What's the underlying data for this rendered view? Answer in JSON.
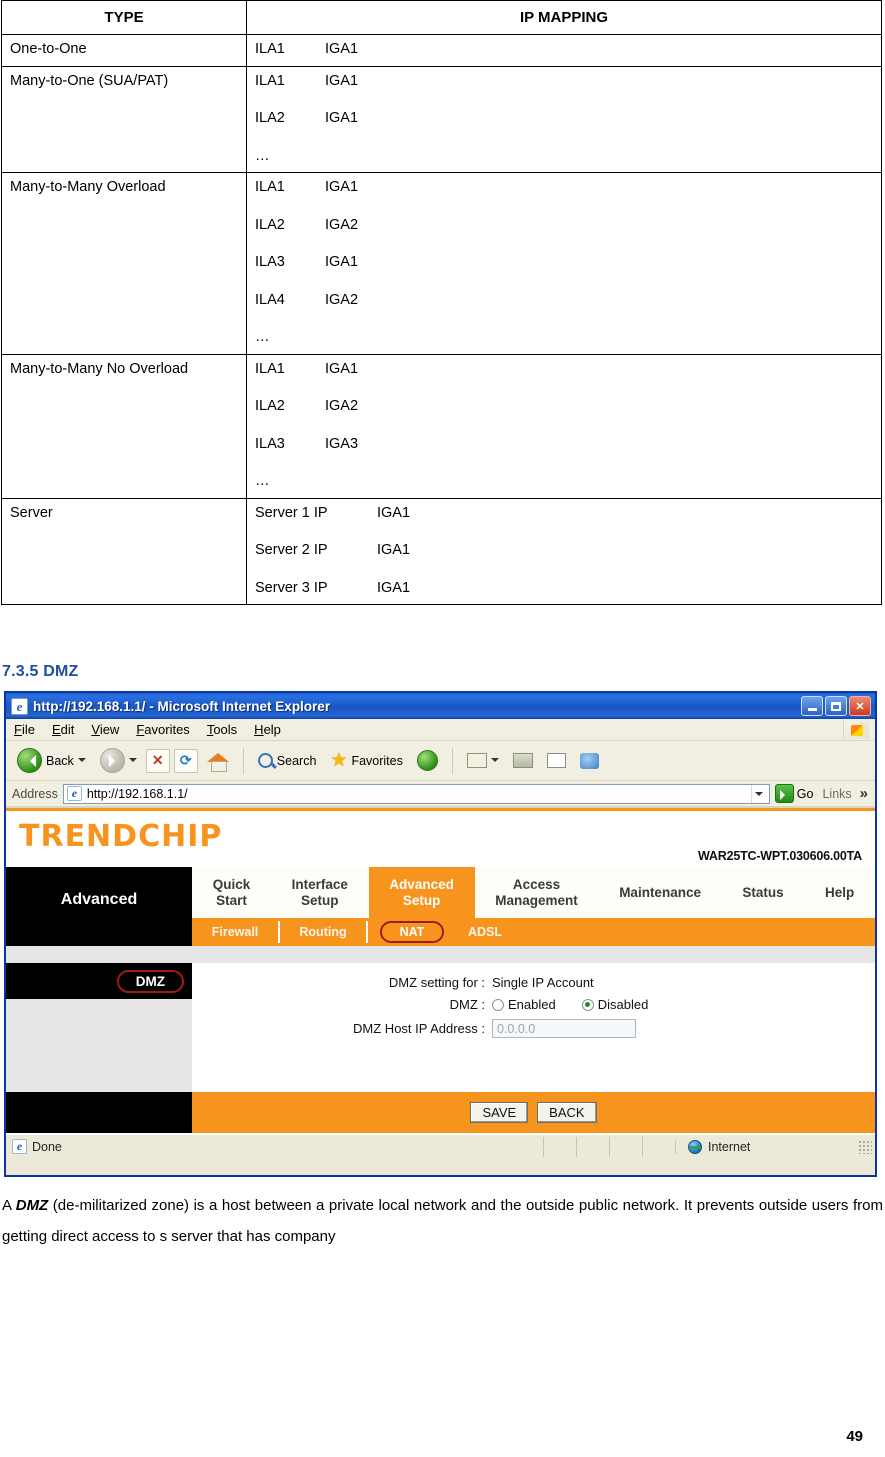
{
  "nat_table": {
    "headers": [
      "TYPE",
      "IP MAPPING"
    ],
    "rows": [
      {
        "type": "One-to-One",
        "mappings": [
          [
            "ILA1",
            "IGA1"
          ]
        ],
        "wide": false
      },
      {
        "type": "Many-to-One (SUA/PAT)",
        "mappings": [
          [
            "ILA1",
            "IGA1"
          ],
          [
            "ILA2",
            "IGA1"
          ],
          [
            "…",
            ""
          ]
        ],
        "wide": false
      },
      {
        "type": "Many-to-Many Overload",
        "mappings": [
          [
            "ILA1",
            "IGA1"
          ],
          [
            "ILA2",
            "IGA2"
          ],
          [
            "ILA3",
            "IGA1"
          ],
          [
            "ILA4",
            "IGA2"
          ],
          [
            "…",
            ""
          ]
        ],
        "wide": false
      },
      {
        "type": "Many-to-Many No Overload",
        "mappings": [
          [
            "ILA1",
            "IGA1"
          ],
          [
            "ILA2",
            "IGA2"
          ],
          [
            "ILA3",
            "IGA3"
          ],
          [
            "…",
            ""
          ]
        ],
        "wide": false
      },
      {
        "type": "Server",
        "mappings": [
          [
            "Server 1 IP",
            "IGA1"
          ],
          [
            "Server 2 IP",
            "IGA1"
          ],
          [
            "Server 3 IP",
            "IGA1"
          ]
        ],
        "wide": true
      }
    ]
  },
  "section": {
    "heading": "7.3.5 DMZ",
    "heading_color": "#1F4E9C"
  },
  "browser": {
    "title": "http://192.168.1.1/ - Microsoft Internet Explorer",
    "window_buttons": {
      "minimize": "_",
      "maximize": "□",
      "close": "✕"
    },
    "menus": [
      "File",
      "Edit",
      "View",
      "Favorites",
      "Tools",
      "Help"
    ],
    "toolbar": {
      "back": "Back",
      "forward": "",
      "stop": "✕",
      "refresh": "⟳",
      "home": "",
      "search": "Search",
      "favorites": "Favorites",
      "history": "",
      "mail": "",
      "print": "",
      "edit": "",
      "messenger": ""
    },
    "address": {
      "label": "Address",
      "url": "http://192.168.1.1/",
      "go_label": "Go",
      "links_label": "Links",
      "chevron": "»"
    },
    "status": {
      "text": "Done",
      "zone": "Internet"
    }
  },
  "router": {
    "brand": "TRENDCHIP",
    "firmware": "WAR25TC-WPT.030606.00TA",
    "accent_color": "#F7941D",
    "sidebar_title": "Advanced",
    "nav_tabs": [
      {
        "label": "Quick\nStart",
        "line1": "Quick",
        "line2": "Start",
        "active": false
      },
      {
        "label": "Interface\nSetup",
        "line1": "Interface",
        "line2": "Setup",
        "active": false
      },
      {
        "label": "Advanced\nSetup",
        "line1": "Advanced",
        "line2": "Setup",
        "active": true
      },
      {
        "label": "Access\nManagement",
        "line1": "Access",
        "line2": "Management",
        "active": false
      },
      {
        "label": "Maintenance",
        "line1": "Maintenance",
        "line2": "",
        "active": false
      },
      {
        "label": "Status",
        "line1": "Status",
        "line2": "",
        "active": false
      },
      {
        "label": "Help",
        "line1": "Help",
        "line2": "",
        "active": false
      }
    ],
    "sub_tabs": [
      {
        "label": "Firewall",
        "selected": false
      },
      {
        "label": "Routing",
        "selected": false
      },
      {
        "label": "NAT",
        "selected": true
      },
      {
        "label": "ADSL",
        "selected": false
      }
    ],
    "panel_badge": "DMZ",
    "form": {
      "setting_for_label": "DMZ setting for :",
      "setting_for_value": "Single IP Account",
      "dmz_label": "DMZ :",
      "dmz_options": [
        {
          "label": "Enabled",
          "selected": false
        },
        {
          "label": "Disabled",
          "selected": true
        }
      ],
      "host_ip_label": "DMZ Host IP Address :",
      "host_ip_value": "0.0.0.0"
    },
    "buttons": {
      "save": "SAVE",
      "back": "BACK"
    }
  },
  "body_text": {
    "line_prefix": "A ",
    "bold_term": "DMZ",
    "paragraph": " (de-militarized zone) is a host between a private local network and the outside public network. It prevents outside users from getting direct access to s server that has company"
  },
  "page_number": "49"
}
